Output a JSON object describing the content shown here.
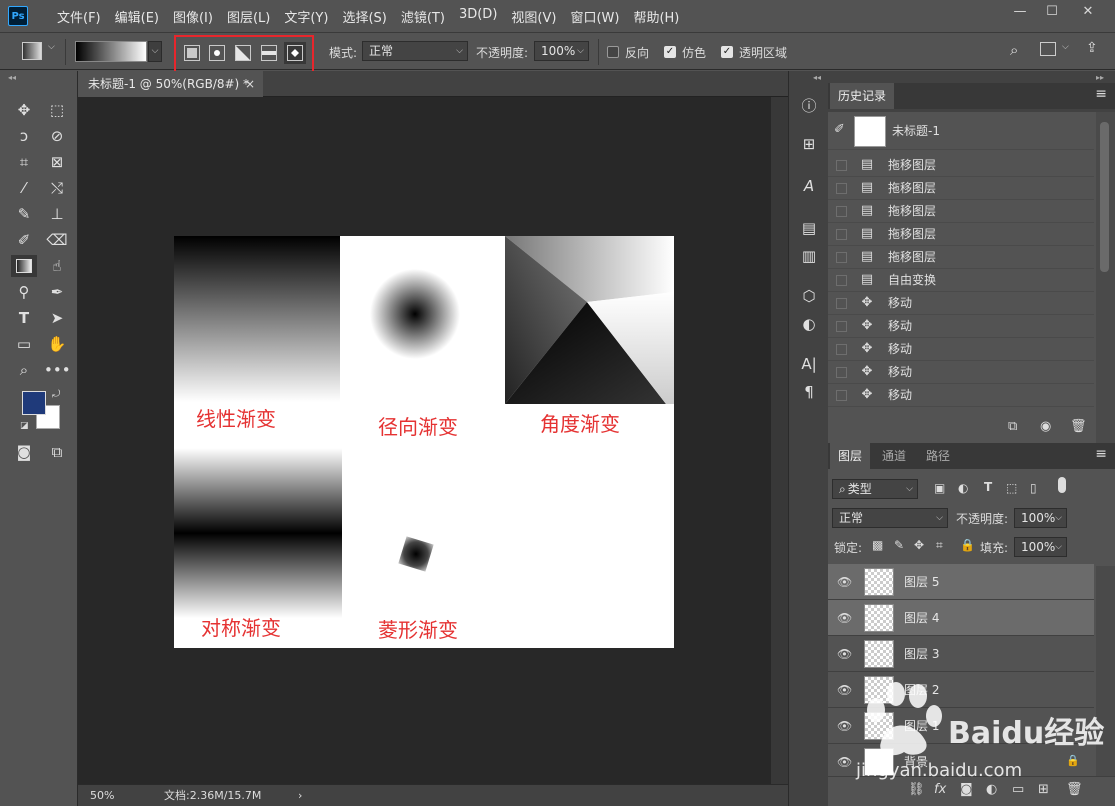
{
  "app": {
    "logo": "Ps"
  },
  "menu": [
    "文件(F)",
    "编辑(E)",
    "图像(I)",
    "图层(L)",
    "文字(Y)",
    "选择(S)",
    "滤镜(T)",
    "3D(D)",
    "视图(V)",
    "窗口(W)",
    "帮助(H)"
  ],
  "window_controls": {
    "minimize": "—",
    "maximize": "☐",
    "close": "✕"
  },
  "options": {
    "mode_label": "模式:",
    "mode_value": "正常",
    "opacity_label": "不透明度:",
    "opacity_value": "100%",
    "reverse_label": "反向",
    "reverse_checked": false,
    "dither_label": "仿色",
    "dither_checked": true,
    "transparency_label": "透明区域",
    "transparency_checked": true,
    "gradient_types": [
      "linear",
      "radial",
      "angle",
      "reflected",
      "diamond"
    ],
    "selected_gradient_type": "diamond"
  },
  "document": {
    "tab_title": "未标题-1 @ 50%(RGB/8#) *",
    "tab_close": "×",
    "zoom": "50%",
    "doc_info": "文档:2.36M/15.7M",
    "status_arrow": "›"
  },
  "canvas_labels": {
    "linear": "线性渐变",
    "radial": "径向渐变",
    "angle": "角度渐变",
    "reflected": "对称渐变",
    "diamond": "菱形渐变"
  },
  "history": {
    "tab": "历史记录",
    "snapshot": "未标题-1",
    "items": [
      {
        "icon": "document-icon",
        "label": "拖移图层"
      },
      {
        "icon": "document-icon",
        "label": "拖移图层"
      },
      {
        "icon": "document-icon",
        "label": "拖移图层"
      },
      {
        "icon": "document-icon",
        "label": "拖移图层"
      },
      {
        "icon": "document-icon",
        "label": "拖移图层"
      },
      {
        "icon": "document-icon",
        "label": "自由变换"
      },
      {
        "icon": "move-icon",
        "label": "移动"
      },
      {
        "icon": "move-icon",
        "label": "移动"
      },
      {
        "icon": "move-icon",
        "label": "移动"
      },
      {
        "icon": "move-icon",
        "label": "移动"
      },
      {
        "icon": "move-icon",
        "label": "移动"
      }
    ]
  },
  "layers_panel": {
    "tabs": [
      "图层",
      "通道",
      "路径"
    ],
    "filter_label": "类型",
    "blend_mode": "正常",
    "opacity_label": "不透明度:",
    "opacity_value": "100%",
    "lock_label": "锁定:",
    "fill_label": "填充:",
    "fill_value": "100%",
    "layers": [
      {
        "name": "图层 5",
        "selected": true
      },
      {
        "name": "图层 4",
        "selected": true
      },
      {
        "name": "图层 3",
        "selected": false
      },
      {
        "name": "图层 2",
        "selected": false
      },
      {
        "name": "图层 1",
        "selected": false
      },
      {
        "name": "背景",
        "selected": false,
        "locked": true
      }
    ]
  },
  "colors": {
    "foreground": "#1f3a7a",
    "background": "#ffffff",
    "highlight": "#e8262c",
    "label_red": "#e53232"
  },
  "watermark": {
    "brand": "Baidu经验",
    "url": "jingyan.baidu.com"
  }
}
